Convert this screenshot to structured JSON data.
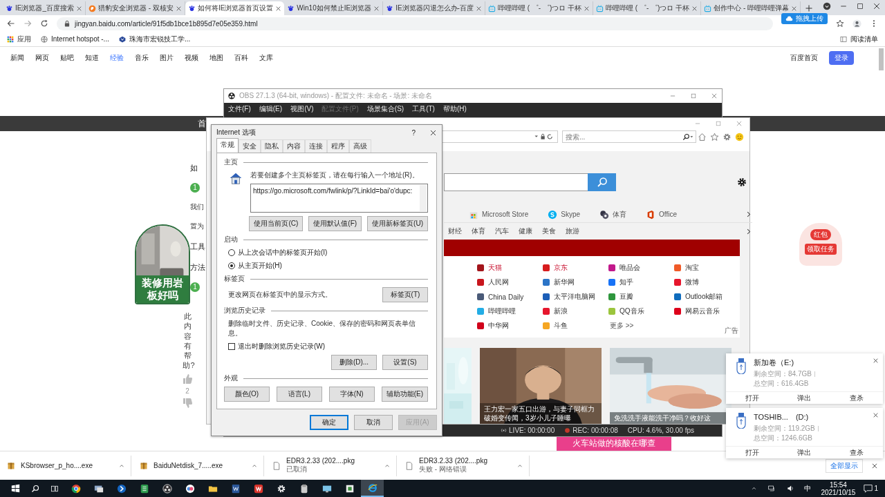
{
  "browser": {
    "tabs": [
      {
        "title": "IE浏览器_百度搜索",
        "kind": "baidu",
        "selected": false
      },
      {
        "title": "猎豹安全浏览器 - 双核安",
        "kind": "cheetah",
        "selected": false
      },
      {
        "title": "如何将IE浏览器首页设置",
        "kind": "baidu",
        "selected": true
      },
      {
        "title": "Win10如何禁止IE浏览器",
        "kind": "baidu",
        "selected": false
      },
      {
        "title": "IE浏览器闪退怎么办-百度",
        "kind": "baidu",
        "selected": false
      },
      {
        "title": "哔哩哔哩 ( ゜- ゜)つロ 干杯",
        "kind": "bilibili",
        "selected": false
      },
      {
        "title": "哔哩哔哩 ( ゜- ゜)つロ 干杯",
        "kind": "bilibili",
        "selected": false
      },
      {
        "title": "创作中心 - 哔哩哔哩弹幕",
        "kind": "bilibili",
        "selected": false
      }
    ],
    "address": "jingyan.baidu.com/article/91f5db1bce1b895d7e05e359.html",
    "upload_badge": "拖拽上传",
    "bookmarks": [
      "应用",
      "Internet hotspot -...",
      "珠海市宏锐技工学..."
    ],
    "reading_list": "阅读清单"
  },
  "page": {
    "nav": [
      {
        "label": "新闻",
        "selected": false
      },
      {
        "label": "网页",
        "selected": false
      },
      {
        "label": "贴吧",
        "selected": false
      },
      {
        "label": "知道",
        "selected": false
      },
      {
        "label": "经验",
        "selected": true
      },
      {
        "label": "音乐",
        "selected": false
      },
      {
        "label": "图片",
        "selected": false
      },
      {
        "label": "视频",
        "selected": false
      },
      {
        "label": "地图",
        "selected": false
      },
      {
        "label": "百科",
        "selected": false
      },
      {
        "label": "文库",
        "selected": false
      }
    ],
    "home_link": "百度首页",
    "login": "登录",
    "band_text": "首",
    "ad_text": "装修用岩板好吗",
    "fragments": [
      {
        "kind": "heading",
        "text": "如"
      },
      {
        "kind": "step",
        "text": "1"
      },
      {
        "kind": "text",
        "text": "我们"
      },
      {
        "kind": "text",
        "text": "置为"
      },
      {
        "kind": "heading",
        "text": "工具"
      },
      {
        "kind": "heading",
        "text": "方法"
      },
      {
        "kind": "step",
        "text": "1"
      }
    ],
    "help_prompt": "此内容有帮助?",
    "likes": "2",
    "red_packet": {
      "title": "红包",
      "action": "领取任务"
    },
    "banner_ad": "火车站做的核酸在哪查"
  },
  "obs": {
    "title": "OBS 27.1.3 (64-bit, windows) - 配置文件: 未命名 - 场景: 未命名",
    "menu": [
      {
        "label": "文件(F)",
        "disabled": false
      },
      {
        "label": "编辑(E)",
        "disabled": false
      },
      {
        "label": "视图(V)",
        "disabled": false
      },
      {
        "label": "配置文件(P)",
        "disabled": true
      },
      {
        "label": "场景集合(S)",
        "disabled": false
      },
      {
        "label": "工具(T)",
        "disabled": false
      },
      {
        "label": "帮助(H)",
        "disabled": false
      }
    ],
    "status": [
      {
        "kind": "live",
        "text": "LIVE: 00:00:00"
      },
      {
        "kind": "rec",
        "text": "REC: 00:00:08"
      },
      {
        "kind": "cpu",
        "text": "CPU: 4.6%, 30.00 fps"
      }
    ]
  },
  "ie": {
    "search_placeholder": "搜索...",
    "quick_links": [
      {
        "label": "Microsoft Store",
        "kind": "store"
      },
      {
        "label": "Skype",
        "kind": "skype"
      },
      {
        "label": "体育",
        "kind": "ball"
      },
      {
        "label": "Office",
        "kind": "office"
      }
    ],
    "categories": [
      "财经",
      "体育",
      "汽车",
      "健康",
      "美食",
      "旅游"
    ],
    "sites": [
      {
        "label": "天猫",
        "color": "#a3151b",
        "hot": true
      },
      {
        "label": "京东",
        "color": "#d71c1e",
        "hot": true
      },
      {
        "label": "唯品会",
        "color": "#c2188b",
        "hot": false
      },
      {
        "label": "淘宝",
        "color": "#f05a28",
        "hot": false
      },
      {
        "label": "人民网",
        "color": "#c8161d",
        "hot": false
      },
      {
        "label": "新华网",
        "color": "#2b74c7",
        "hot": false
      },
      {
        "label": "知乎",
        "color": "#1772f6",
        "hot": false
      },
      {
        "label": "微博",
        "color": "#e6162d",
        "hot": false
      },
      {
        "label": "China Daily",
        "color": "#4a5a78",
        "hot": false
      },
      {
        "label": "太平洋电脑网",
        "color": "#1c5fb8",
        "hot": false
      },
      {
        "label": "豆瓣",
        "color": "#2e963d",
        "hot": false
      },
      {
        "label": "Outlook邮箱",
        "color": "#0f6cbd",
        "hot": false
      },
      {
        "label": "哔哩哔哩",
        "color": "#23ade5",
        "hot": false
      },
      {
        "label": "新浪",
        "color": "#e6162d",
        "hot": false
      },
      {
        "label": "QQ音乐",
        "color": "#9bc53d",
        "hot": false
      },
      {
        "label": "网易云音乐",
        "color": "#dd001b",
        "hot": false
      },
      {
        "label": "中华网",
        "color": "#d0021b",
        "hot": false
      },
      {
        "label": "斗鱼",
        "color": "#f5a623",
        "hot": false
      },
      {
        "label": "更多 >>",
        "kind": "more",
        "hot": false
      }
    ],
    "ad_label": "广告",
    "news": [
      {
        "caption": "王力宏一家五口出游，与妻子同框力破婚变传闻，3岁小儿子睡曝"
      },
      {
        "caption": "免洗洗手液能洗干净吗？收好这"
      }
    ]
  },
  "dialog": {
    "title": "Internet 选项",
    "help": "?",
    "tabs": [
      {
        "label": "常规",
        "selected": true
      },
      {
        "label": "安全",
        "selected": false
      },
      {
        "label": "隐私",
        "selected": false
      },
      {
        "label": "内容",
        "selected": false
      },
      {
        "label": "连接",
        "selected": false
      },
      {
        "label": "程序",
        "selected": false
      },
      {
        "label": "高级",
        "selected": false
      }
    ],
    "home": {
      "label": "主页",
      "hint": "若要创建多个主页标签页，请在每行输入一个地址(R)。",
      "value": "https://go.microsoft.com/fwlink/p/?LinkId=bai'o'dupc:",
      "buttons": [
        "使用当前页(C)",
        "使用默认值(F)",
        "使用新标签页(U)"
      ]
    },
    "startup": {
      "label": "启动",
      "options": [
        {
          "label": "从上次会话中的标签页开始(I)",
          "selected": false
        },
        {
          "label": "从主页开始(H)",
          "selected": true
        }
      ]
    },
    "tabs_section": {
      "label": "标签页",
      "hint": "更改网页在标签页中的显示方式。",
      "button": "标签页(T)"
    },
    "history": {
      "label": "浏览历史记录",
      "hint": "删除临时文件、历史记录、Cookie、保存的密码和网页表单信息。",
      "checkbox": {
        "label": "退出时删除浏览历史记录(W)",
        "checked": false
      },
      "buttons": [
        "删除(D)...",
        "设置(S)"
      ]
    },
    "appearance": {
      "label": "外观",
      "buttons": [
        "颜色(O)",
        "语言(L)",
        "字体(N)",
        "辅助功能(E)"
      ]
    },
    "footer": [
      {
        "label": "确定",
        "disabled": false,
        "default": true
      },
      {
        "label": "取消",
        "disabled": false,
        "default": false
      },
      {
        "label": "应用(A)",
        "disabled": true,
        "default": false
      }
    ]
  },
  "drives": [
    {
      "name": "新加卷（E:)",
      "free": "剩余空间：84.7GB",
      "total": "总空间：616.4GB",
      "actions": [
        "打开",
        "弹出",
        "查杀"
      ]
    },
    {
      "name": "TOSHIB...　(D:)",
      "free": "剩余空间：119.2GB",
      "total": "总空间：1246.6GB",
      "actions": [
        "打开",
        "弹出",
        "查杀"
      ]
    }
  ],
  "downloads": {
    "items": [
      {
        "name": "KSbrowser_p_ho....exe",
        "kind": "box"
      },
      {
        "name": "BaiduNetdisk_7.....exe",
        "kind": "box"
      },
      {
        "name": "EDR3.2.33 (202....pkg",
        "kind": "file",
        "status": "已取消"
      },
      {
        "name": "EDR3.2.33 (202....pkg",
        "kind": "file",
        "status": "失败 - 网络错误"
      }
    ],
    "show_all": "全部显示"
  },
  "taskbar": {
    "apps": [
      {
        "kind": "chrome",
        "selected": false
      },
      {
        "kind": "computer",
        "selected": false
      },
      {
        "kind": "arrow",
        "selected": false
      },
      {
        "kind": "sheet",
        "selected": false
      },
      {
        "kind": "obs",
        "selected": false
      },
      {
        "kind": "cloud",
        "selected": false
      },
      {
        "kind": "folder",
        "selected": false
      },
      {
        "kind": "word",
        "selected": false
      },
      {
        "kind": "wps",
        "selected": false
      },
      {
        "kind": "gear",
        "selected": false
      },
      {
        "kind": "tool",
        "selected": false
      },
      {
        "kind": "monitor",
        "selected": false
      },
      {
        "kind": "disk",
        "selected": false
      },
      {
        "kind": "ie",
        "selected": true
      }
    ],
    "ime": "中",
    "time": "15:54",
    "date": "2021/10/15",
    "notifications": "1"
  }
}
